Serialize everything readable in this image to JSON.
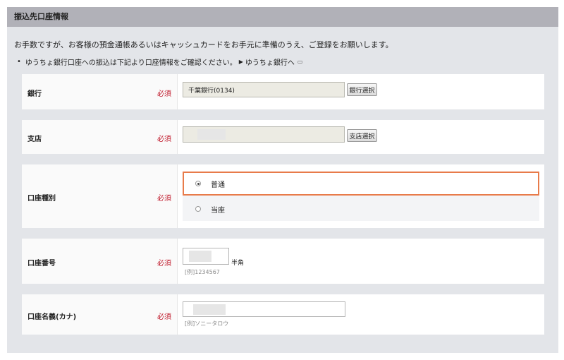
{
  "header": {
    "title": "振込先口座情報"
  },
  "intro": "お手数ですが、お客様の預金通帳あるいはキャッシュカードをお手元に準備のうえ、ご登録をお願いします。",
  "note": {
    "bullet": "•",
    "text": "ゆうちょ銀行口座への振込は下記より口座情報をご確認ください。",
    "link": "ゆうちょ銀行へ"
  },
  "required_label": "必須",
  "bank": {
    "label": "銀行",
    "value": "千葉銀行(0134)",
    "button": "銀行選択"
  },
  "branch": {
    "label": "支店",
    "button": "支店選択"
  },
  "account_type": {
    "label": "口座種別",
    "options": [
      "普通",
      "当座"
    ],
    "selected": "普通"
  },
  "account_number": {
    "label": "口座番号",
    "unit": "半角",
    "example": "[例]1234567"
  },
  "account_name": {
    "label": "口座名義(カナ)",
    "example": "[例]ソニータロウ"
  },
  "colors": {
    "header_bg": "#b1b1b8",
    "panel_bg": "#e3e5e9",
    "required": "#c0182a",
    "selected_border": "#e87b4a"
  }
}
